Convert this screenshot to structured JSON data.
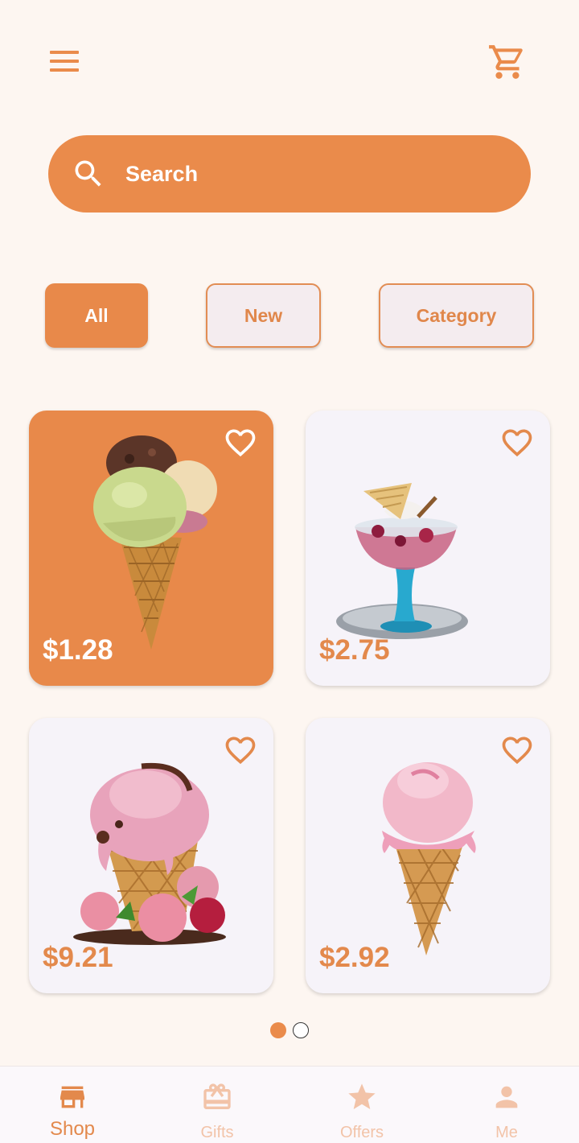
{
  "colors": {
    "accent": "#ea8b4b",
    "background": "#fdf6f1",
    "card": "#f6f3f9",
    "nav_inactive": "#f2c3a8"
  },
  "header": {
    "menu_icon": "hamburger-menu-icon",
    "cart_icon": "shopping-cart-icon"
  },
  "search": {
    "placeholder": "Search",
    "icon": "search-icon"
  },
  "filters": [
    {
      "label": "All",
      "active": true
    },
    {
      "label": "New",
      "active": false
    },
    {
      "label": "Category",
      "active": false
    }
  ],
  "products": [
    {
      "price": "$1.28",
      "image": "triple-scoop-cone",
      "selected": true,
      "favorite_icon": "heart-outline-icon"
    },
    {
      "price": "$2.75",
      "image": "sundae-glass",
      "selected": false,
      "favorite_icon": "heart-outline-icon"
    },
    {
      "price": "$9.21",
      "image": "strawberry-waffle-cone",
      "selected": false,
      "favorite_icon": "heart-outline-icon"
    },
    {
      "price": "$2.92",
      "image": "pink-single-cone",
      "selected": false,
      "favorite_icon": "heart-outline-icon"
    }
  ],
  "pager": {
    "current": 1,
    "total": 2
  },
  "nav": [
    {
      "label": "Shop",
      "icon": "store-icon",
      "active": true
    },
    {
      "label": "Gifts",
      "icon": "gift-icon",
      "active": false
    },
    {
      "label": "Offers",
      "icon": "star-icon",
      "active": false
    },
    {
      "label": "Me",
      "icon": "person-icon",
      "active": false
    }
  ]
}
